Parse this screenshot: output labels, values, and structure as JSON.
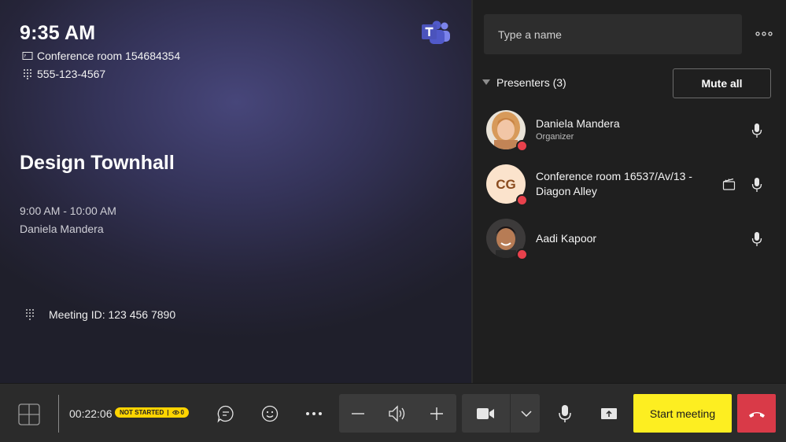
{
  "meeting_info": {
    "time": "9:35 AM",
    "room": "Conference room 154684354",
    "phone": "555-123-4567",
    "title": "Design Townhall",
    "schedule": "9:00 AM - 10:00 AM",
    "organizer": "Daniela Mandera",
    "meeting_id": "Meeting ID: 123 456 7890"
  },
  "roster": {
    "search_placeholder": "Type a name",
    "section_label": "Presenters (3)",
    "mute_all_label": "Mute all",
    "people": [
      {
        "name": "Daniela Mandera",
        "role": "Organizer",
        "avatar": "photo",
        "status_color": "#e8414c"
      },
      {
        "name": "Conference room 16537/Av/13 - Diagon Alley",
        "initials": "CG",
        "avatar": "initials",
        "has_room_icon": true,
        "status_color": "#e8414c"
      },
      {
        "name": "Aadi Kapoor",
        "avatar": "photo",
        "status_color": "#e8414c"
      }
    ]
  },
  "toolbar": {
    "elapsed": "00:22:06",
    "status_badge": "NOT STARTED",
    "viewer_count": "0",
    "start_label": "Start meeting",
    "icons": [
      "gallery-icon",
      "chat-icon",
      "emoji-icon",
      "more-icon",
      "volume-down-icon",
      "speaker-icon",
      "volume-up-icon",
      "camera-icon",
      "chevron-down-icon",
      "mic-icon",
      "share-screen-icon",
      "hang-up-icon"
    ]
  },
  "colors": {
    "accent_yellow": "#fdee21",
    "hangup_red": "#d93a48",
    "status_red": "#e8414c",
    "teams_purple": "#5059c9"
  }
}
